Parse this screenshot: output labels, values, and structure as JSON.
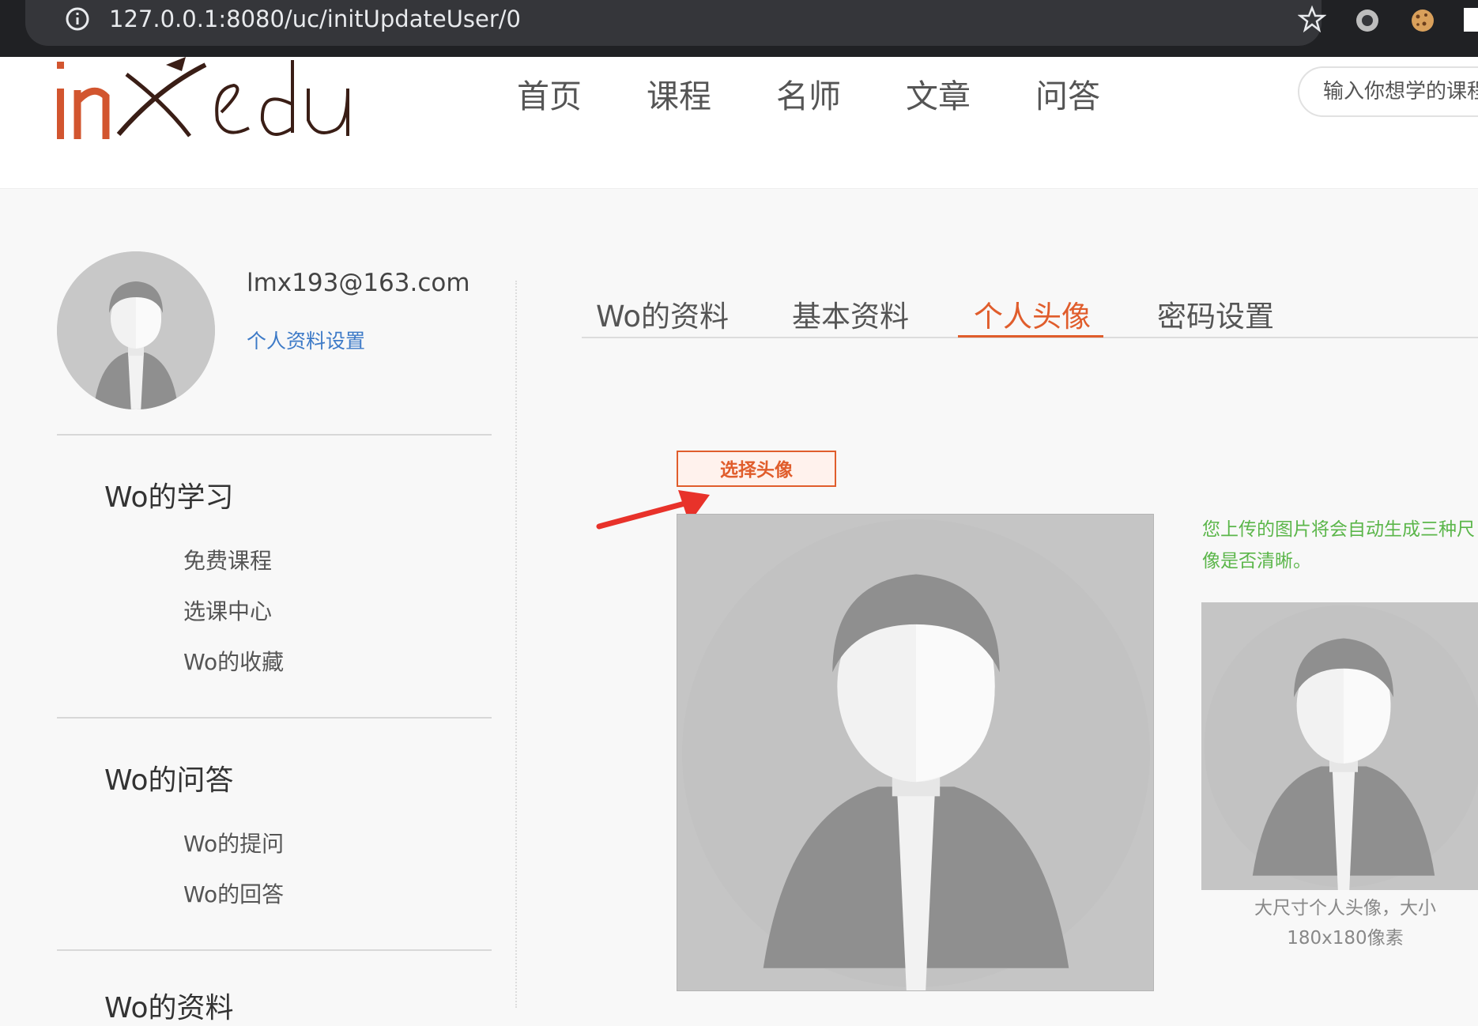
{
  "browser": {
    "url": "127.0.0.1:8080/uc/initUpdateUser/0",
    "icons": [
      "info-icon",
      "star-icon",
      "record-extension-icon",
      "cookie-extension-icon",
      "qr-extension-icon"
    ]
  },
  "header": {
    "logo_text": "inxedu",
    "nav": [
      "首页",
      "课程",
      "名师",
      "文章",
      "问答"
    ],
    "search_placeholder": "输入你想学的课程"
  },
  "user": {
    "email": "lmx193@163.com",
    "settings_link": "个人资料设置"
  },
  "sidebar": {
    "sections": [
      {
        "title": "Wo的学习",
        "items": [
          "免费课程",
          "选课中心",
          "Wo的收藏"
        ]
      },
      {
        "title": "Wo的问答",
        "items": [
          "Wo的提问",
          "Wo的回答"
        ]
      },
      {
        "title": "Wo的资料",
        "items": []
      }
    ]
  },
  "tabs": {
    "items": [
      "Wo的资料",
      "基本资料",
      "个人头像",
      "密码设置"
    ],
    "active": "个人头像"
  },
  "upload": {
    "choose_button": "选择头像",
    "hint_line1": "您上传的图片将会自动生成三种尺",
    "hint_line2": "像是否清晰。",
    "caption_line1": "大尺寸个人头像，大小",
    "caption_line2": "180x180像素"
  },
  "colors": {
    "accent": "#e05d2c",
    "link": "#3d7ac7",
    "hint_green": "#5bb64a",
    "annotation_arrow": "#e8322a"
  }
}
